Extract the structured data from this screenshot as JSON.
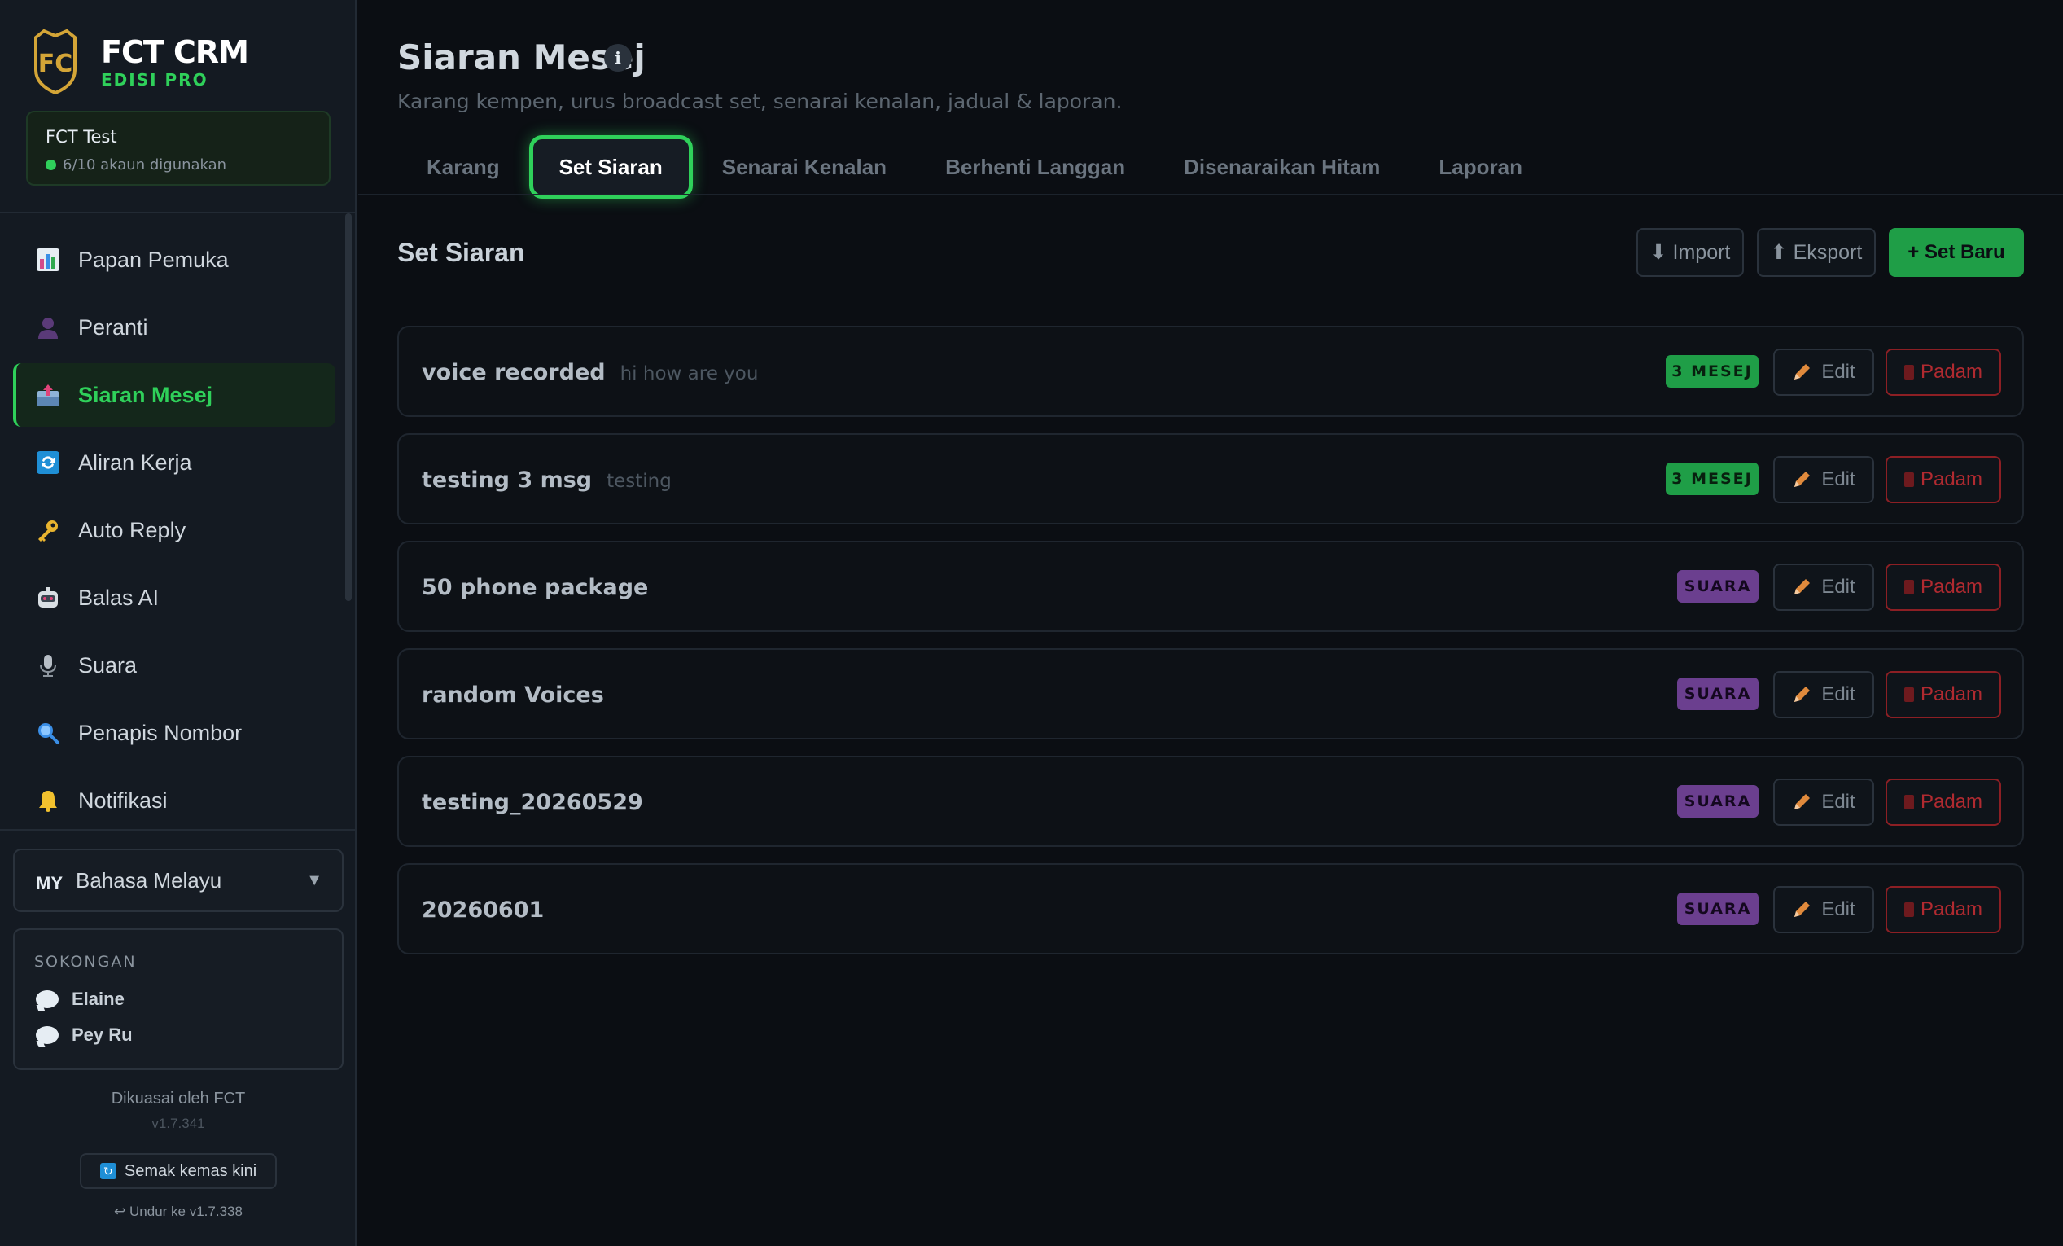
{
  "brand": {
    "title": "FCT CRM",
    "edition": "EDISI PRO",
    "logo_text": "FC"
  },
  "account": {
    "name": "FCT Test",
    "usage": "6/10 akaun digunakan"
  },
  "nav": [
    {
      "label": "Papan Pemuka",
      "icon": "bar-chart-icon"
    },
    {
      "label": "Peranti",
      "icon": "person-icon"
    },
    {
      "label": "Siaran Mesej",
      "icon": "outbox-icon",
      "active": true
    },
    {
      "label": "Aliran Kerja",
      "icon": "refresh-icon"
    },
    {
      "label": "Auto Reply",
      "icon": "key-icon"
    },
    {
      "label": "Balas AI",
      "icon": "robot-icon"
    },
    {
      "label": "Suara",
      "icon": "microphone-icon"
    },
    {
      "label": "Penapis Nombor",
      "icon": "magnifier-icon"
    },
    {
      "label": "Notifikasi",
      "icon": "bell-icon"
    }
  ],
  "language": {
    "code": "MY",
    "label": "Bahasa Melayu"
  },
  "support": {
    "title": "SOKONGAN",
    "contacts": [
      "Elaine",
      "Pey Ru"
    ]
  },
  "footer": {
    "powered": "Dikuasai oleh FCT",
    "version": "v1.7.341",
    "update_label": "Semak kemas kini",
    "downgrade_label": "↩ Undur ke v1.7.338"
  },
  "page": {
    "title": "Siaran Mesej",
    "subtitle": "Karang kempen, urus broadcast set, senarai kenalan, jadual & laporan."
  },
  "tabs": [
    {
      "label": "Karang"
    },
    {
      "label": "Set Siaran",
      "active": true
    },
    {
      "label": "Senarai Kenalan"
    },
    {
      "label": "Berhenti Langgan"
    },
    {
      "label": "Disenaraikan Hitam"
    },
    {
      "label": "Laporan"
    }
  ],
  "section": {
    "title": "Set Siaran",
    "import_label": "⬇ Import",
    "export_label": "⬆ Eksport",
    "new_label": "+ Set Baru"
  },
  "sets": [
    {
      "name": "voice recorded",
      "desc": "hi how are you",
      "badge": "3 MESEJ",
      "badge_type": "green"
    },
    {
      "name": "testing 3 msg",
      "desc": "testing",
      "badge": "3 MESEJ",
      "badge_type": "green"
    },
    {
      "name": "50 phone package",
      "desc": "",
      "badge": "SUARA",
      "badge_type": "purple"
    },
    {
      "name": "random Voices",
      "desc": "",
      "badge": "SUARA",
      "badge_type": "purple"
    },
    {
      "name": "testing_20260529",
      "desc": "",
      "badge": "SUARA",
      "badge_type": "purple"
    },
    {
      "name": "20260601",
      "desc": "",
      "badge": "SUARA",
      "badge_type": "purple"
    }
  ],
  "row_actions": {
    "edit_label": "Edit",
    "delete_label": "Padam"
  },
  "colors": {
    "accent": "#2fd05a",
    "danger": "#b02a30",
    "purple": "#6b3f8f"
  }
}
